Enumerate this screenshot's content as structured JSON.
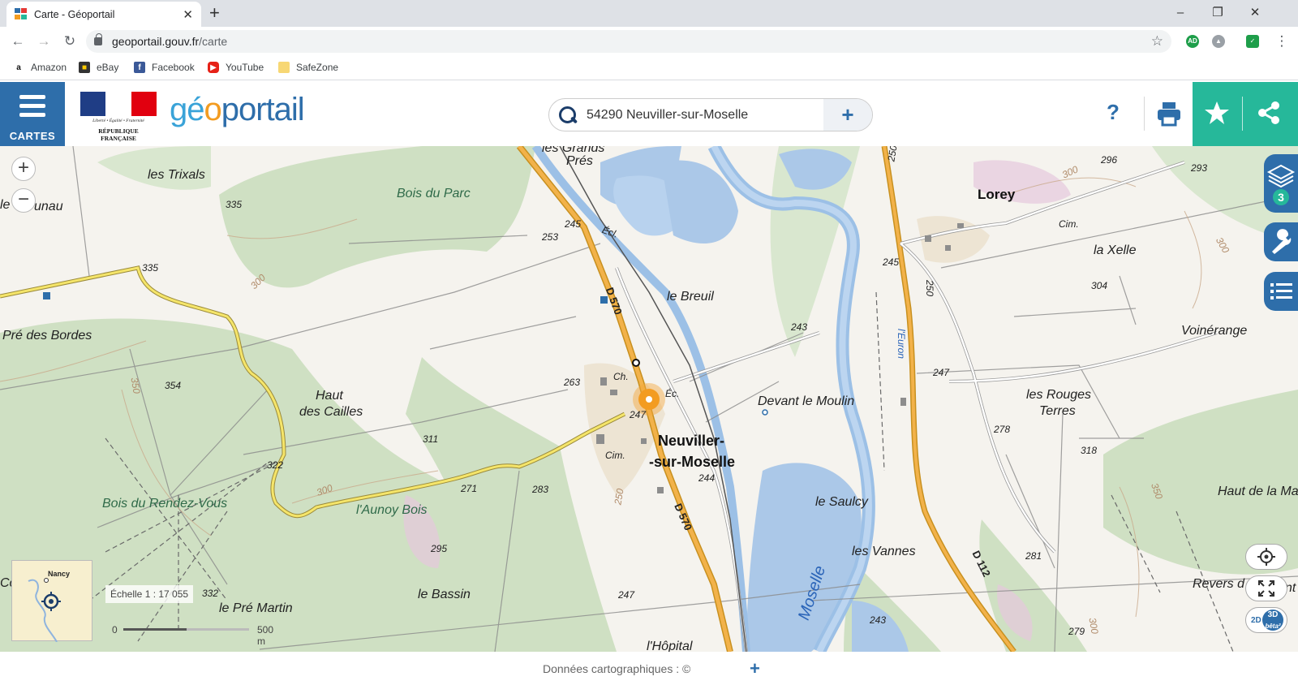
{
  "browser": {
    "tab_title": "Carte - Géoportail",
    "tab_close": "✕",
    "new_tab": "+",
    "win_min": "–",
    "win_max": "❐",
    "win_close": "✕",
    "url_host": "geoportail.gouv.fr",
    "url_path": "/carte",
    "bookmarks": [
      "Amazon",
      "eBay",
      "Facebook",
      "YouTube",
      "SafeZone"
    ],
    "ext_ad": "AD"
  },
  "header": {
    "cartes_label": "CARTES",
    "motto": "Liberté • Égalité • Fraternité",
    "republique": "RÉPUBLIQUE FRANÇAISE",
    "logo_part1": "gé",
    "logo_part2": "o",
    "logo_part3": "portail",
    "search_value": "54290 Neuviller-sur-Moselle",
    "search_plus": "+",
    "help": "?",
    "accent_blue": "#2e6eaa",
    "accent_green": "#26b89a"
  },
  "map": {
    "zoom_in": "+",
    "zoom_out": "−",
    "layers_count": "3",
    "overview_label": "Nancy",
    "scale_text": "Échelle 1 : 17 055",
    "scale_zero": "0",
    "scale_max": "500 m",
    "mode_2d": "2D",
    "mode_3d": "3D",
    "mode_beta": "bêta²",
    "labels": {
      "les_grands_pres_1": "les Grands",
      "les_grands_pres_2": "Prés",
      "les_trixals": "les Trixals",
      "bois_du_parc": "Bois du Parc",
      "le_aunau_1": "le",
      "le_aunau_2": "unau",
      "pre_des_bordes": "Pré des Bordes",
      "haut_des_cailles_1": "Haut",
      "haut_des_cailles_2": "des Cailles",
      "le_breuil": "le Breuil",
      "neuviller_1": "Neuviller-",
      "neuviller_2": "-sur-Moselle",
      "devant_le_moulin": "Devant le Moulin",
      "lorey": "Lorey",
      "la_xelle": "la Xelle",
      "voinerange": "Voinérange",
      "les_rouges_terres_1": "les Rouges",
      "les_rouges_terres_2": "Terres",
      "bois_du_rendez_vous": "Bois du Rendez-Vous",
      "launoy_bois": "l'Aunoy Bois",
      "le_saulcy": "le Saulcy",
      "les_vannes": "les Vannes",
      "haut_de_la_ma": "Haut de la Ma",
      "revers_de": "Revers d",
      "le_pre_martin": "le Pré Martin",
      "le_bassin": "le Bassin",
      "lhopital": "l'Hôpital",
      "moselle": "Moselle",
      "leuron": "l'Euron",
      "co": "Co",
      "ch": "Ch.",
      "ec1": "Éc.",
      "ec2": "Écl.",
      "cim1": "Cim.",
      "cim2": "Cim.",
      "d570_1": "D 570",
      "d570_2": "D 570",
      "d112": "D 112",
      "nt": "nt"
    },
    "altitudes": {
      "a335a": "335",
      "a335b": "335",
      "a245a": "245",
      "a253": "253",
      "a300a": "300",
      "a354": "354",
      "a350a": "350",
      "a263": "263",
      "a247a": "247",
      "a311": "311",
      "a322": "322",
      "a300b": "300",
      "a271": "271",
      "a283": "283",
      "a250a": "250",
      "a244": "244",
      "a243a": "243",
      "a245b": "245",
      "a250b": "250",
      "a247b": "247",
      "a250c": "250",
      "a296": "296",
      "a300c": "300",
      "a293": "293",
      "a300d": "300",
      "a304": "304",
      "a278": "278",
      "a318": "318",
      "a350b": "350",
      "a295": "295",
      "a332": "332",
      "a247c": "247",
      "a243b": "243",
      "a281": "281",
      "a279": "279",
      "a300e": "300"
    }
  },
  "footer": {
    "credits": "Données cartographiques : ©",
    "plus": "+"
  }
}
